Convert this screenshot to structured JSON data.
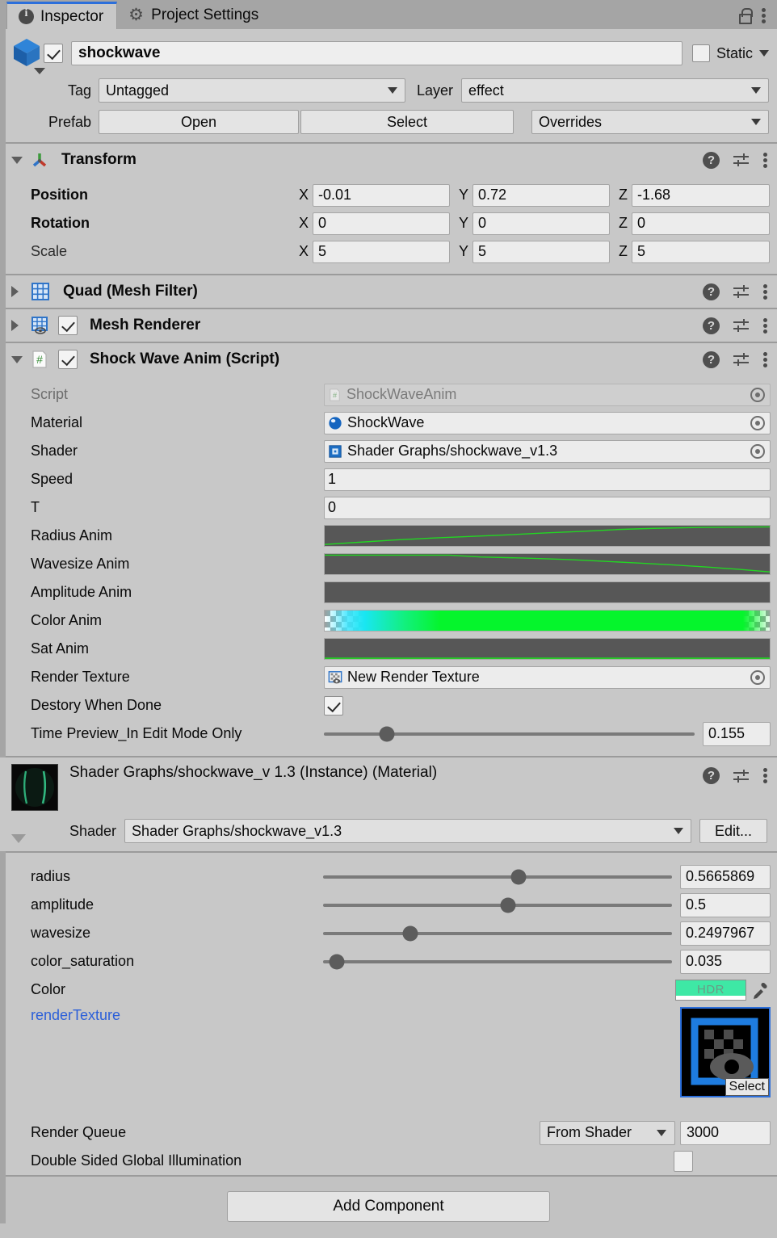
{
  "tabs": [
    {
      "label": "Inspector",
      "icon": "info-icon",
      "active": true
    },
    {
      "label": "Project Settings",
      "icon": "gear-icon",
      "active": false
    }
  ],
  "window_icons": {
    "lock": "lock-icon",
    "menu": "kebab-menu-icon"
  },
  "gameobject": {
    "name": "shockwave",
    "enabled": true,
    "static_label": "Static",
    "tag_label": "Tag",
    "tag_value": "Untagged",
    "layer_label": "Layer",
    "layer_value": "effect",
    "prefab_label": "Prefab",
    "prefab_open": "Open",
    "prefab_select": "Select",
    "prefab_overrides": "Overrides"
  },
  "transform": {
    "title": "Transform",
    "rows": [
      {
        "name": "Position",
        "x": "-0.01",
        "y": "0.72",
        "z": "-1.68",
        "bold": true
      },
      {
        "name": "Rotation",
        "x": "0",
        "y": "0",
        "z": "0",
        "bold": true
      },
      {
        "name": "Scale",
        "x": "5",
        "y": "5",
        "z": "5",
        "bold": false
      }
    ],
    "axis_labels": [
      "X",
      "Y",
      "Z"
    ]
  },
  "components": [
    {
      "title": "Quad (Mesh Filter)",
      "has_checkbox": false,
      "expanded": false
    },
    {
      "title": "Mesh Renderer",
      "has_checkbox": true,
      "checked": true,
      "expanded": false
    }
  ],
  "script_component": {
    "title": "Shock Wave Anim (Script)",
    "enabled": true,
    "rows": [
      {
        "label": "Script",
        "type": "object",
        "value": "ShockWaveAnim",
        "icon": "script-icon",
        "disabled": true
      },
      {
        "label": "Material",
        "type": "object",
        "value": "ShockWave",
        "icon": "material-icon",
        "disabled": false
      },
      {
        "label": "Shader",
        "type": "object",
        "value": "Shader Graphs/shockwave_v1.3",
        "icon": "shader-icon",
        "disabled": false
      },
      {
        "label": "Speed",
        "type": "number",
        "value": "1"
      },
      {
        "label": "T",
        "type": "number",
        "value": "0"
      },
      {
        "label": "Radius Anim",
        "type": "curve",
        "curve": "rising"
      },
      {
        "label": "Wavesize Anim",
        "type": "curve",
        "curve": "falling"
      },
      {
        "label": "Amplitude Anim",
        "type": "curve",
        "curve": "empty"
      },
      {
        "label": "Color Anim",
        "type": "gradient"
      },
      {
        "label": "Sat Anim",
        "type": "curve",
        "curve": "flat-bottom"
      },
      {
        "label": "Render Texture",
        "type": "object",
        "value": "New Render Texture",
        "icon": "render-texture-icon",
        "disabled": false
      },
      {
        "label": "Destory When Done",
        "type": "checkbox",
        "checked": true
      },
      {
        "label": "Time Preview_In Edit Mode Only",
        "type": "slider",
        "value": "0.155",
        "percent": 17
      }
    ]
  },
  "material": {
    "header_title": "Shader Graphs/shockwave_v 1.3  (Instance)  (Material)",
    "shader_label": "Shader",
    "shader_value": "Shader Graphs/shockwave_v1.3",
    "edit_label": "Edit...",
    "properties": [
      {
        "label": "radius",
        "value": "0.5665869",
        "percent": 56
      },
      {
        "label": "amplitude",
        "value": "0.5",
        "percent": 53
      },
      {
        "label": "wavesize",
        "value": "0.2497967",
        "percent": 25
      },
      {
        "label": "color_saturation",
        "value": "0.035",
        "percent": 4
      }
    ],
    "color_label": "Color",
    "color_hdr_label": "HDR",
    "color_value": "#3EE8A5",
    "texture_label": "renderTexture",
    "texture_select_label": "Select",
    "render_queue_label": "Render Queue",
    "render_queue_mode": "From Shader",
    "render_queue_value": "3000",
    "double_sided_label": "Double Sided Global Illumination",
    "double_sided_checked": false
  },
  "footer": {
    "add_component_label": "Add Component"
  }
}
